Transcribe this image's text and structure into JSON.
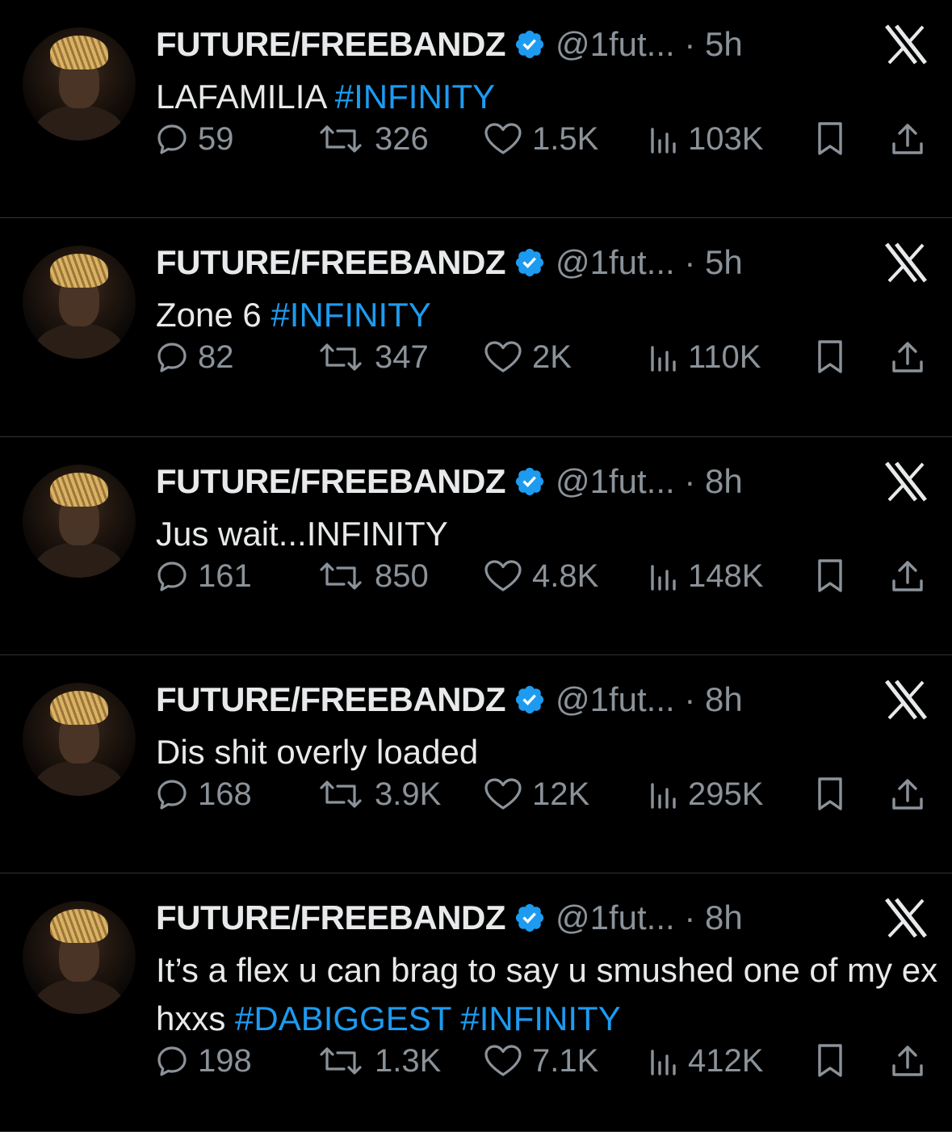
{
  "colors": {
    "background": "#000000",
    "text": "#e7e9ea",
    "muted": "#8b9299",
    "link": "#1d9bf0",
    "divider": "#2f3336"
  },
  "tweets": [
    {
      "name": "FUTURE/FREEBANDZ",
      "handle": "@1fut...",
      "time": "5h",
      "text": [
        [
          "LAFAMILIA ",
          false
        ],
        [
          "#INFINITY",
          true
        ]
      ],
      "replies": "59",
      "reposts": "326",
      "likes": "1.5K",
      "views": "103K"
    },
    {
      "name": "FUTURE/FREEBANDZ",
      "handle": "@1fut...",
      "time": "5h",
      "text": [
        [
          "Zone 6 ",
          false
        ],
        [
          "#INFINITY",
          true
        ]
      ],
      "replies": "82",
      "reposts": "347",
      "likes": "2K",
      "views": "110K"
    },
    {
      "name": "FUTURE/FREEBANDZ",
      "handle": "@1fut...",
      "time": "8h",
      "text": [
        [
          "Jus wait...INFINITY",
          false
        ]
      ],
      "replies": "161",
      "reposts": "850",
      "likes": "4.8K",
      "views": "148K"
    },
    {
      "name": "FUTURE/FREEBANDZ",
      "handle": "@1fut...",
      "time": "8h",
      "text": [
        [
          "Dis shit overly loaded",
          false
        ]
      ],
      "replies": "168",
      "reposts": "3.9K",
      "likes": "12K",
      "views": "295K"
    },
    {
      "name": "FUTURE/FREEBANDZ",
      "handle": "@1fut...",
      "time": "8h",
      "text": [
        [
          "It’s a flex u can brag to say u smushed one of my ex hxxs ",
          false
        ],
        [
          "#DABIGGEST",
          true
        ],
        [
          " ",
          false
        ],
        [
          "#INFINITY",
          true
        ]
      ],
      "replies": "198",
      "reposts": "1.3K",
      "likes": "7.1K",
      "views": "412K"
    }
  ],
  "icons": [
    "avatar",
    "verified-badge-icon",
    "x-logo-icon",
    "reply-icon",
    "repost-icon",
    "like-icon",
    "views-icon",
    "bookmark-icon",
    "share-icon"
  ]
}
